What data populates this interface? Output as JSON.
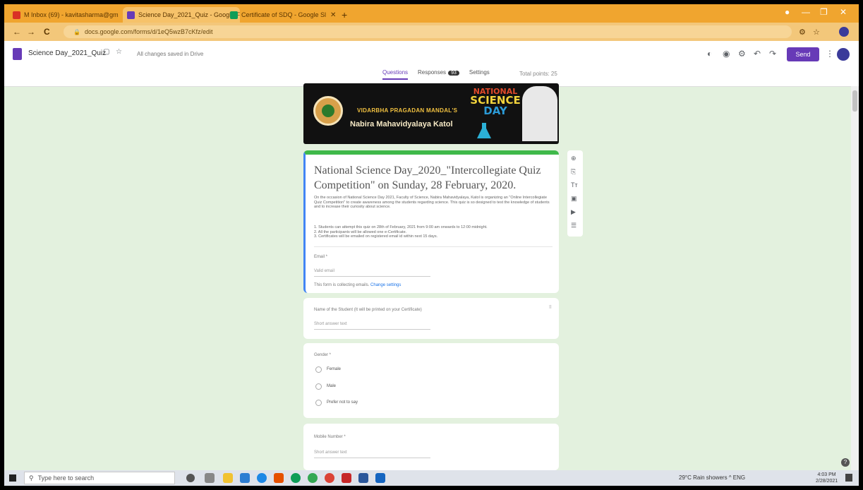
{
  "browser": {
    "tabs": [
      {
        "label": "M  Inbox (69) - kavitasharma@gm",
        "favicon_color": "#d93025",
        "active": false
      },
      {
        "label": "Science Day_2021_Quiz - Google F",
        "favicon_color": "#673ab7",
        "active": true
      },
      {
        "label": "Certificate of SDQ - Google Sl",
        "favicon_color": "#0f9d58",
        "active": false
      }
    ],
    "new_tab": "+",
    "window_controls": [
      "●",
      "—",
      "❐",
      "✕"
    ],
    "nav": {
      "back": "←",
      "forward": "→",
      "reload": "C"
    },
    "url": "docs.google.com/forms/d/1eQ5wzB7cKfz/edit",
    "lock_icon": "🔒"
  },
  "forms_header": {
    "doc_title": "Science Day_2021_Quiz",
    "saved_note": "All changes saved in Drive",
    "send_label": "Send",
    "tabs": [
      {
        "label": "Questions",
        "active": true
      },
      {
        "label": "Responses",
        "active": false,
        "badge": "93"
      },
      {
        "label": "Settings",
        "active": false
      }
    ],
    "total_points": "Total points: 25"
  },
  "banner": {
    "society": "VIDARBHA PRAGADAN MANDAL'S",
    "college": "Nabira Mahavidyalaya Katol",
    "event_line1": "NATIONAL",
    "event_line2": "SCIENCE",
    "event_line3": "DAY"
  },
  "title_card": {
    "title": "National Science Day_2020_\"Intercollegiate Quiz Competition\" on Sunday, 28 February, 2020.",
    "description": "On the occasion of National Science Day 2021, Faculty of Science, Nabira Mahavidyalaya, Katol is organizing an \"Online Intercollegiate Quiz Competition\" to create awareness among the students regarding science. This quiz is so designed to test the knowledge of students and to increase their curiosity about science.",
    "bullets": [
      "1. Students can attempt this quiz on 28th of February, 2021 from 9:00 am onwards to 12:00 midnight.",
      "2. All the participants will be allowed one e-Certificate.",
      "3. Certificates will be emailed on registered email id within next 15 days."
    ],
    "email_label": "Email *",
    "email_placeholder": "Valid email",
    "collecting_note": "This form is collecting emails.",
    "change_settings": "Change settings"
  },
  "side_toolbar": {
    "icons": [
      "⊕",
      "⎘",
      "Tт",
      "▣",
      "▶",
      "☰"
    ]
  },
  "q_name": {
    "label": "Name of the Student (It will be printed on your Certificate)",
    "placeholder": "Short answer text"
  },
  "q_gender": {
    "label": "Gender *",
    "options": [
      "Female",
      "Male",
      "Prefer not to say"
    ]
  },
  "q_mobile": {
    "label": "Mobile Number *",
    "placeholder": "Short answer text"
  },
  "help": "?",
  "taskbar": {
    "search_placeholder": "Type here to search",
    "tray_text": "29°C  Rain showers  ^  ENG",
    "time": "4:03 PM",
    "date": "2/28/2021"
  }
}
